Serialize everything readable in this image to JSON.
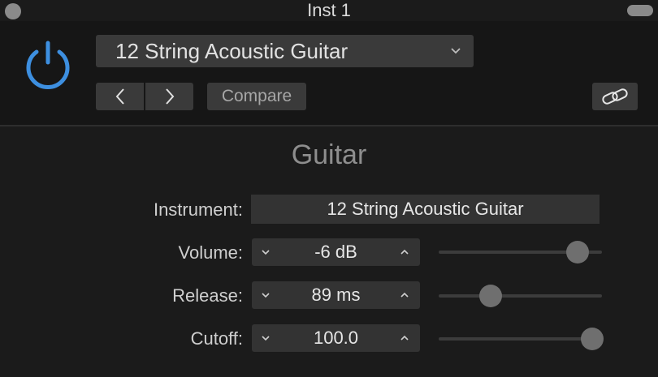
{
  "window": {
    "title": "Inst 1"
  },
  "header": {
    "preset": "12 String Acoustic Guitar",
    "compare_label": "Compare",
    "power_color": "#3d8fe0"
  },
  "section": {
    "title": "Guitar"
  },
  "params": {
    "instrument": {
      "label": "Instrument:",
      "value": "12 String Acoustic Guitar"
    },
    "volume": {
      "label": "Volume:",
      "value": "-6 dB",
      "level": 0.85
    },
    "release": {
      "label": "Release:",
      "value": "89 ms",
      "level": 0.32
    },
    "cutoff": {
      "label": "Cutoff:",
      "value": "100.0",
      "level": 0.94
    }
  }
}
